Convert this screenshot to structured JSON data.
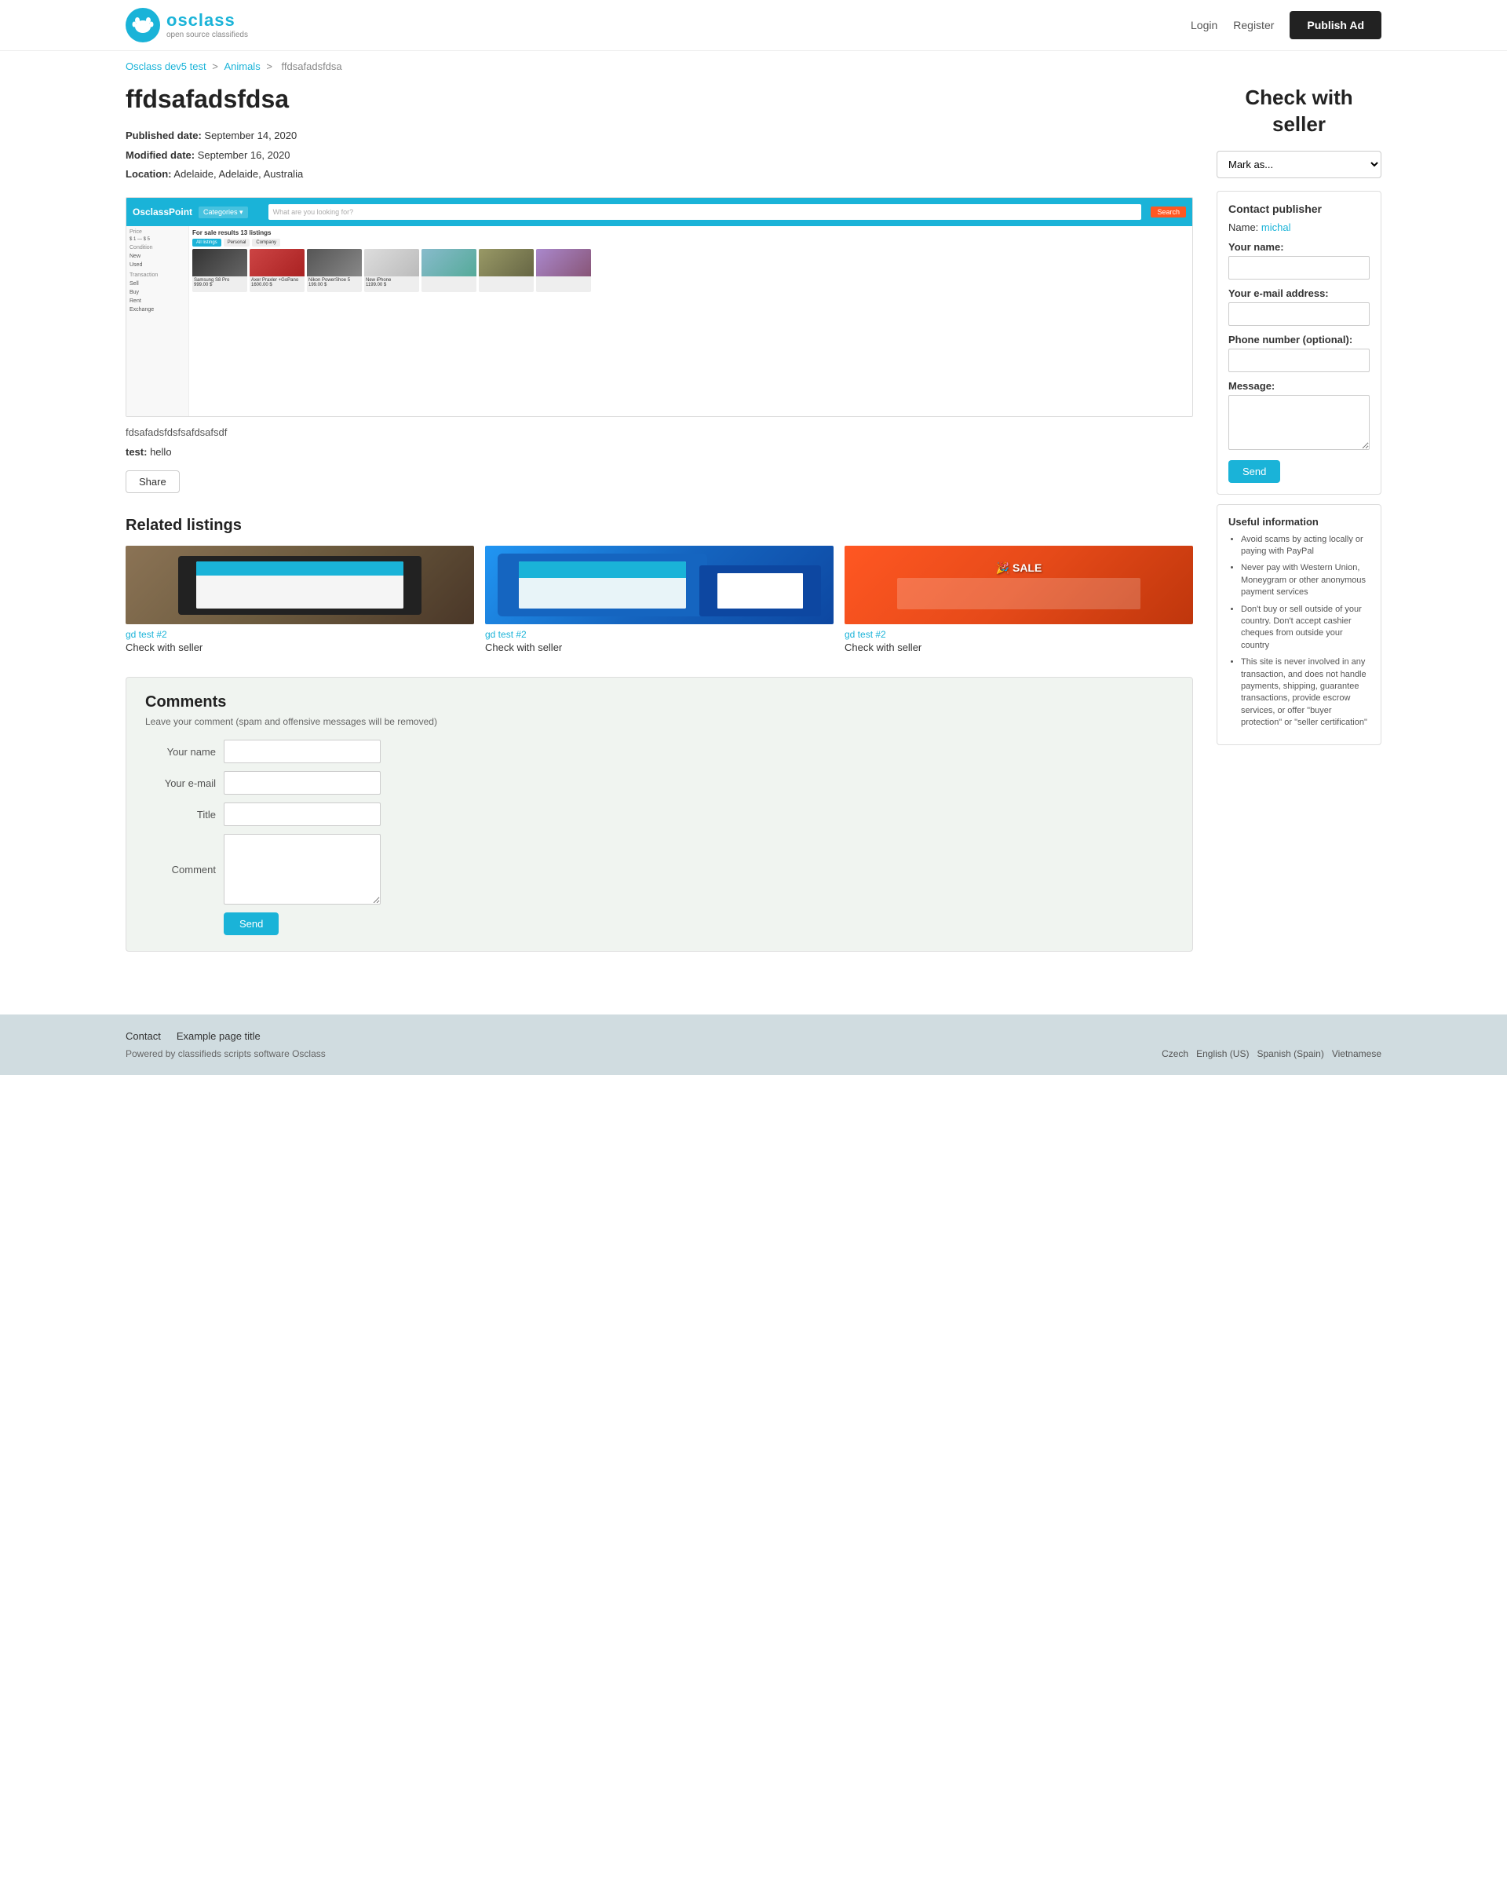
{
  "header": {
    "logo_name": "osclass",
    "logo_sub": "open source classifieds",
    "nav": {
      "login": "Login",
      "register": "Register",
      "publish_ad": "Publish Ad"
    }
  },
  "breadcrumb": {
    "home": "Osclass dev5 test",
    "category": "Animals",
    "current": "ffdsafadsfdsa"
  },
  "ad": {
    "title": "ffdsafadsfdsa",
    "published_label": "Published date:",
    "published_value": "September 14, 2020",
    "modified_label": "Modified date:",
    "modified_value": "September 16, 2020",
    "location_label": "Location:",
    "location_value": "Adelaide, Adelaide, Australia",
    "description": "fdsafadsfdsfsafdsafsdf",
    "test_label": "test:",
    "test_value": "hello",
    "share_button": "Share"
  },
  "right_panel": {
    "title": "Check with seller",
    "mark_placeholder": "Mark as...",
    "contact": {
      "title": "Contact publisher",
      "name_label": "Name:",
      "name_value": "michal",
      "your_name_label": "Your name:",
      "email_label": "Your e-mail address:",
      "phone_label": "Phone number (optional):",
      "message_label": "Message:",
      "send_button": "Send"
    },
    "useful": {
      "title": "Useful information",
      "items": [
        "Avoid scams by acting locally or paying with PayPal",
        "Never pay with Western Union, Moneygram or other anonymous payment services",
        "Don't buy or sell outside of your country. Don't accept cashier cheques from outside your country",
        "This site is never involved in any transaction, and does not handle payments, shipping, guarantee transactions, provide escrow services, or offer \"buyer protection\" or \"seller certification\""
      ]
    }
  },
  "related": {
    "title": "Related listings",
    "items": [
      {
        "category": "gd test #2",
        "title": "Check with seller"
      },
      {
        "category": "gd test #2",
        "title": "Check with seller"
      },
      {
        "category": "gd test #2",
        "title": "Check with seller"
      }
    ]
  },
  "comments": {
    "title": "Comments",
    "subtitle": "Leave your comment (spam and offensive messages will be removed)",
    "name_label": "Your name",
    "email_label": "Your e-mail",
    "title_label": "Title",
    "comment_label": "Comment",
    "send_button": "Send"
  },
  "footer": {
    "links": [
      {
        "label": "Contact"
      },
      {
        "label": "Example page title"
      }
    ],
    "powered_text": "Powered by classifieds scripts software Osclass",
    "languages": [
      {
        "label": "Czech"
      },
      {
        "label": "English (US)"
      },
      {
        "label": "Spanish (Spain)"
      },
      {
        "label": "Vietnamese"
      }
    ]
  }
}
